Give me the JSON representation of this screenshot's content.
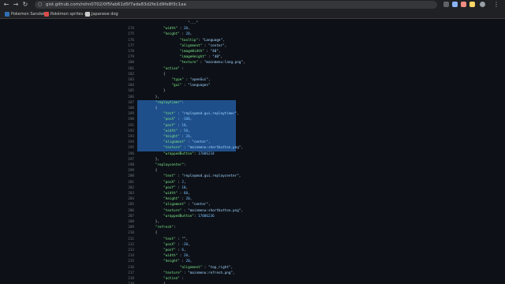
{
  "browser": {
    "url": "gist.github.com/rohn0702/0f5fab61d5f7ada83d2fe1d9fe8f3c1aa",
    "bookmarks": [
      {
        "label": "Pokemon Sandwich...",
        "icon": "pokeball-icon",
        "color": "#2f6fb3"
      },
      {
        "label": "Pokémon sprites ar...",
        "icon": "pokeball-icon",
        "color": "#d94b4b"
      },
      {
        "label": "Japanese dog",
        "icon": "document-icon",
        "color": "#c9c9c9"
      }
    ]
  },
  "code": {
    "lines": [
      {
        "n": "",
        "text": "                        \"...\""
      },
      {
        "n": "174",
        "text": "            \"width\" : 20,"
      },
      {
        "n": "175",
        "text": "            \"height\" : 20,"
      },
      {
        "n": "176",
        "text": "                    \"tooltip\": \"Language\","
      },
      {
        "n": "177",
        "text": "                    \"alignment\" : \"center\","
      },
      {
        "n": "178",
        "text": "                    \"imageWidth\" : \"40\","
      },
      {
        "n": "179",
        "text": "                    \"imageHeight\" : \"40\","
      },
      {
        "n": "180",
        "text": "                    \"texture\" : \"mainmenu:lang.png\","
      },
      {
        "n": "181",
        "text": "            \"action\" :"
      },
      {
        "n": "182",
        "text": "            {"
      },
      {
        "n": "183",
        "text": "                \"type\" : \"openGui\","
      },
      {
        "n": "184",
        "text": "                \"gui\" : \"languages\""
      },
      {
        "n": "185",
        "text": "            }"
      },
      {
        "n": "186",
        "text": "        },"
      },
      {
        "n": "187",
        "text": "        \"replaytimer\":",
        "sel": true
      },
      {
        "n": "188",
        "text": "        {",
        "sel": true
      },
      {
        "n": "189",
        "text": "            \"text\" : \"replaymod.gui.replaytimer\",",
        "sel": true
      },
      {
        "n": "190",
        "text": "            \"posX\" : -100,",
        "sel": true
      },
      {
        "n": "191",
        "text": "            \"posY\" : 10,",
        "sel": true
      },
      {
        "n": "192",
        "text": "            \"width\" : 50,",
        "sel": true
      },
      {
        "n": "193",
        "text": "            \"height\" : 20,",
        "sel": true
      },
      {
        "n": "194",
        "text": "            \"alignment\" : \"center\",",
        "sel": true
      },
      {
        "n": "195",
        "text": "            \"texture\" : \"mainmenu:shortbutton.png\",",
        "sel": true
      },
      {
        "n": "196",
        "text": "            \"wrappedButton\": 17006234"
      },
      {
        "n": "197",
        "text": "        },"
      },
      {
        "n": "198",
        "text": "        \"replaycenter\":"
      },
      {
        "n": "199",
        "text": "        {"
      },
      {
        "n": "200",
        "text": "            \"text\" : \"replaymod.gui.replaycenter\","
      },
      {
        "n": "201",
        "text": "            \"posX\" : 2,"
      },
      {
        "n": "202",
        "text": "            \"posY\" : 10,"
      },
      {
        "n": "203",
        "text": "            \"width\" : 60,"
      },
      {
        "n": "204",
        "text": "            \"height\" : 20,"
      },
      {
        "n": "205",
        "text": "            \"alignment\" : \"center\","
      },
      {
        "n": "206",
        "text": "            \"texture\" : \"mainmenu:shortbutton.png\","
      },
      {
        "n": "207",
        "text": "            \"wrappedButton\": 17006236"
      },
      {
        "n": "208",
        "text": "        },"
      },
      {
        "n": "209",
        "text": "        \"refresh\":"
      },
      {
        "n": "210",
        "text": "        {"
      },
      {
        "n": "211",
        "text": "            \"text\" : \"\","
      },
      {
        "n": "212",
        "text": "            \"posX\" : -20,"
      },
      {
        "n": "213",
        "text": "            \"posY\" : 6,"
      },
      {
        "n": "214",
        "text": "            \"width\" : 20,"
      },
      {
        "n": "215",
        "text": "            \"height\" : 20,"
      },
      {
        "n": "216",
        "text": "                    \"alignment\" : \"top_right\","
      },
      {
        "n": "217",
        "text": "            \"texture\" : \"mainmenu:refresh.png\","
      },
      {
        "n": "218",
        "text": "            \"action\" :"
      },
      {
        "n": "219",
        "text": "            {"
      },
      {
        "n": "220",
        "text": "                \"type\" : \"refresh\""
      }
    ]
  }
}
